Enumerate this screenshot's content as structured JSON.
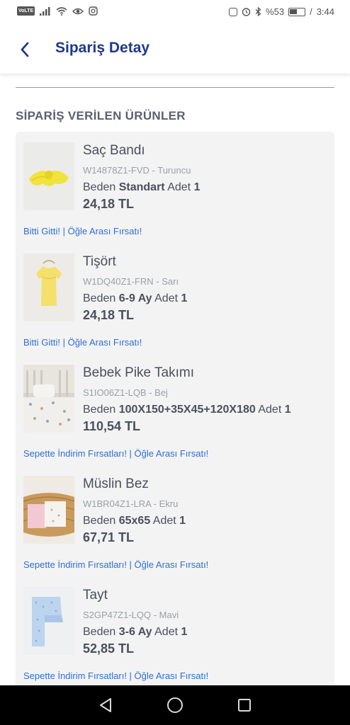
{
  "status_bar": {
    "volte": "VoLTE",
    "battery_text": "%53",
    "battery_level": 0.53,
    "time": "3:44"
  },
  "header": {
    "title": "Sipariş Detay"
  },
  "section": {
    "title": "SİPARİŞ VERİLEN ÜRÜNLER"
  },
  "items": [
    {
      "name": "Saç Bandı",
      "code": "W14878Z1-FVD - Turuncu",
      "size_label": "Beden",
      "size": "Standart",
      "qty_label": "Adet",
      "qty": "1",
      "price": "24,18 TL",
      "campaign": "Bitti Gitti! | Öğle Arası Fırsatı!",
      "image": "yellow-headband"
    },
    {
      "name": "Tişört",
      "code": "W1DQ40Z1-FRN - Sarı",
      "size_label": "Beden",
      "size": "6-9 Ay",
      "qty_label": "Adet",
      "qty": "1",
      "price": "24,18 TL",
      "campaign": "Bitti Gitti! | Öğle Arası Fırsatı!",
      "image": "yellow-tshirt"
    },
    {
      "name": "Bebek Pike Takımı",
      "code": "S1IO06Z1-LQB - Bej",
      "size_label": "Beden",
      "size": "100X150+35X45+120X180",
      "qty_label": "Adet",
      "qty": "1",
      "price": "110,54 TL",
      "campaign": "Sepette İndirim Fırsatları! | Öğle Arası Fırsatı!",
      "image": "crib-bedding"
    },
    {
      "name": "Müslin Bez",
      "code": "W1BR04Z1-LRA - Ekru",
      "size_label": "Beden",
      "size": "65x65",
      "qty_label": "Adet",
      "qty": "1",
      "price": "67,71 TL",
      "campaign": "Sepette İndirim Fırsatları! | Öğle Arası Fırsatı!",
      "image": "muslin-basket"
    },
    {
      "name": "Tayt",
      "code": "S2GP47Z1-LQQ - Mavi",
      "size_label": "Beden",
      "size": "3-6 Ay",
      "qty_label": "Adet",
      "qty": "1",
      "price": "52,85 TL",
      "campaign": "Sepette İndirim Fırsatları! | Öğle Arası Fırsatı!",
      "image": "blue-leggings"
    }
  ],
  "colors": {
    "title": "#1e3a8a",
    "link": "#2f6fd0",
    "card_bg": "#f3f3f4",
    "text": "#4a505c"
  }
}
